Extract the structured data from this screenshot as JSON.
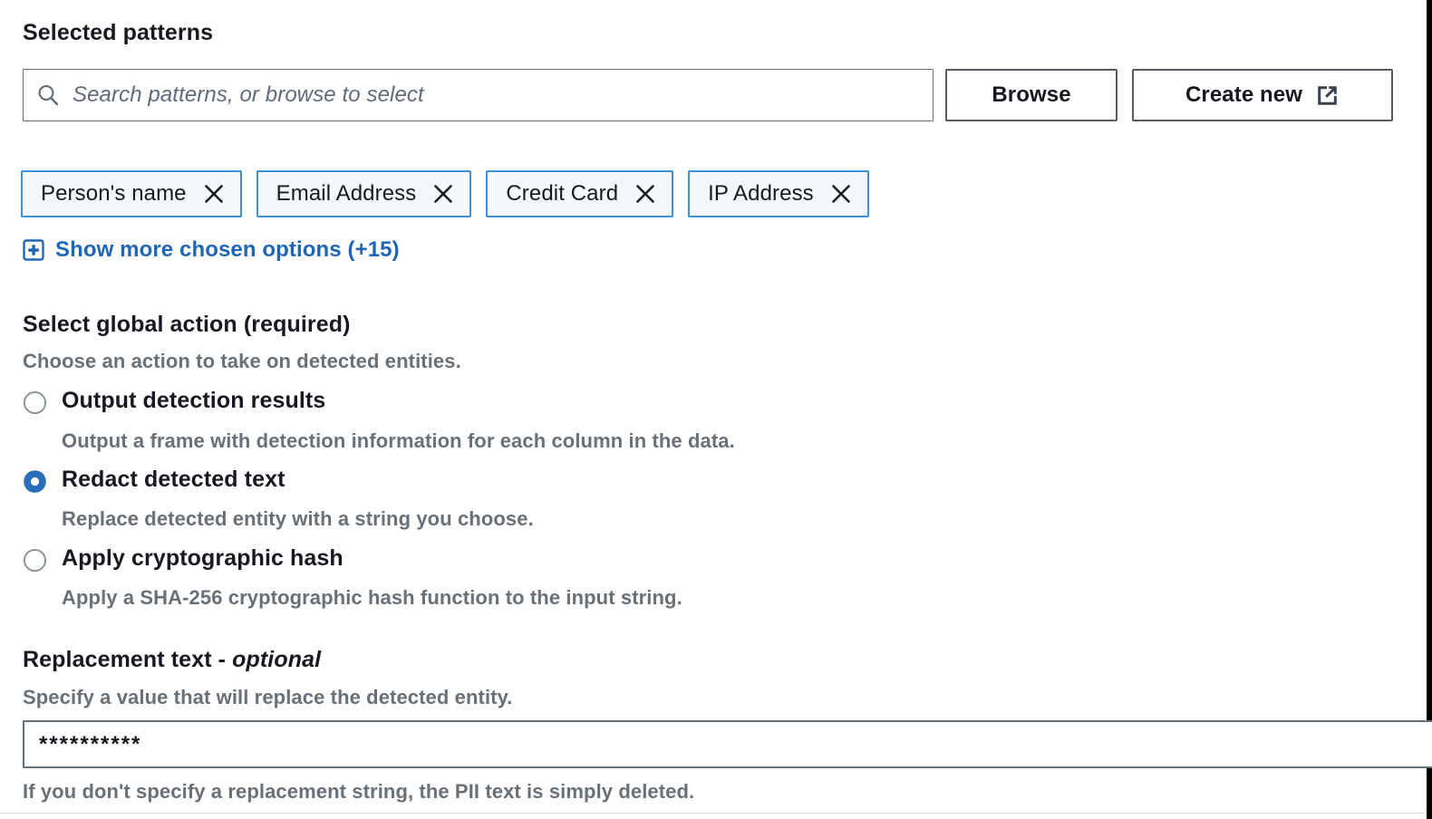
{
  "section": {
    "label": "Selected patterns"
  },
  "search": {
    "placeholder": "Search patterns, or browse to select",
    "icon": "search-icon",
    "value": ""
  },
  "buttons": {
    "browse": "Browse",
    "create_new": "Create new",
    "create_new_icon": "external-link-icon"
  },
  "chips": [
    {
      "label": "Person's name",
      "remove_icon": "close-icon"
    },
    {
      "label": "Email Address",
      "remove_icon": "close-icon"
    },
    {
      "label": "Credit Card",
      "remove_icon": "close-icon"
    },
    {
      "label": "IP Address",
      "remove_icon": "close-icon"
    }
  ],
  "show_more": {
    "label": "Show more chosen options (+15)",
    "icon": "plus-square-icon",
    "hidden_count": 15
  },
  "global_action": {
    "title": "Select global action (required)",
    "subtitle": "Choose an action to take on detected entities.",
    "options": [
      {
        "label": "Output detection results",
        "description": "Output a frame with detection information for each column in the data.",
        "selected": false
      },
      {
        "label": "Redact detected text",
        "description": "Replace detected entity with a string you choose.",
        "selected": true
      },
      {
        "label": "Apply cryptographic hash",
        "description": "Apply a SHA-256 cryptographic hash function to the input string.",
        "selected": false
      }
    ]
  },
  "replacement_text": {
    "title_main": "Replacement text - ",
    "title_optional": "optional",
    "subtitle": "Specify a value that will replace the detected entity.",
    "value": "**********",
    "hint": "If you don't specify a replacement string, the PII text is simply deleted."
  },
  "colors": {
    "accent_blue": "#1f66b8",
    "chip_border": "#3f8fd4",
    "chip_fill": "#f4f8fd",
    "radio_selected": "#2a6ebb",
    "text_primary": "#16191f",
    "text_secondary": "#687078",
    "border_gray": "#687078"
  }
}
